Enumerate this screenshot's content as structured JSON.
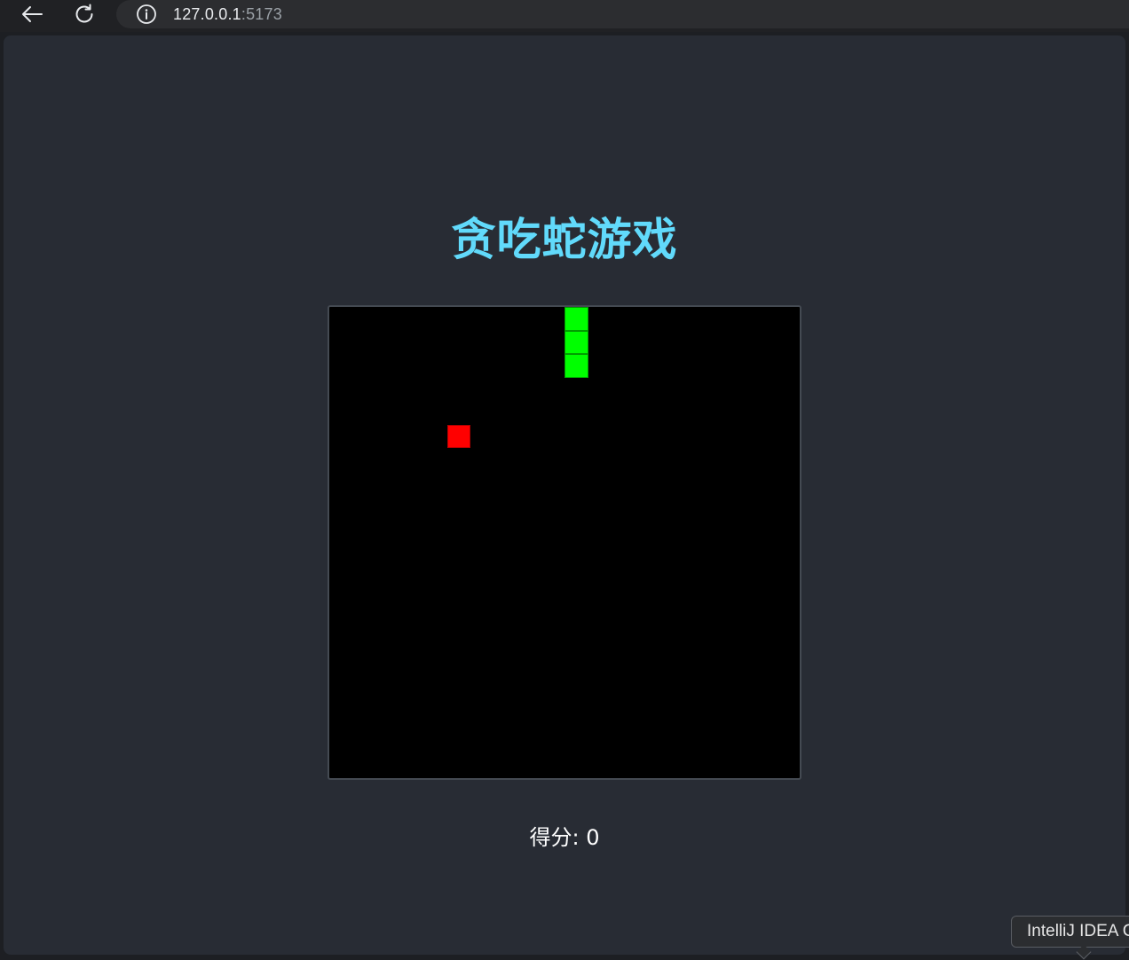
{
  "browser": {
    "url_host": "127.0.0.1",
    "url_port": ":5173",
    "back_icon": "arrow-left-icon",
    "reload_icon": "reload-icon",
    "site_info_icon": "info-circle-icon"
  },
  "game": {
    "title": "贪吃蛇游戏",
    "title_color": "#61dafb",
    "score_label": "得分: 0",
    "score_value": 0,
    "grid_cells": 20,
    "snake_color": "#00ff00",
    "food_color": "#ff0000",
    "board_color": "#000000",
    "snake": [
      {
        "col": 10,
        "row": 0
      },
      {
        "col": 10,
        "row": 1
      },
      {
        "col": 10,
        "row": 2
      }
    ],
    "food": {
      "col": 5,
      "row": 5
    }
  },
  "tooltip": {
    "text": "IntelliJ IDEA C"
  }
}
